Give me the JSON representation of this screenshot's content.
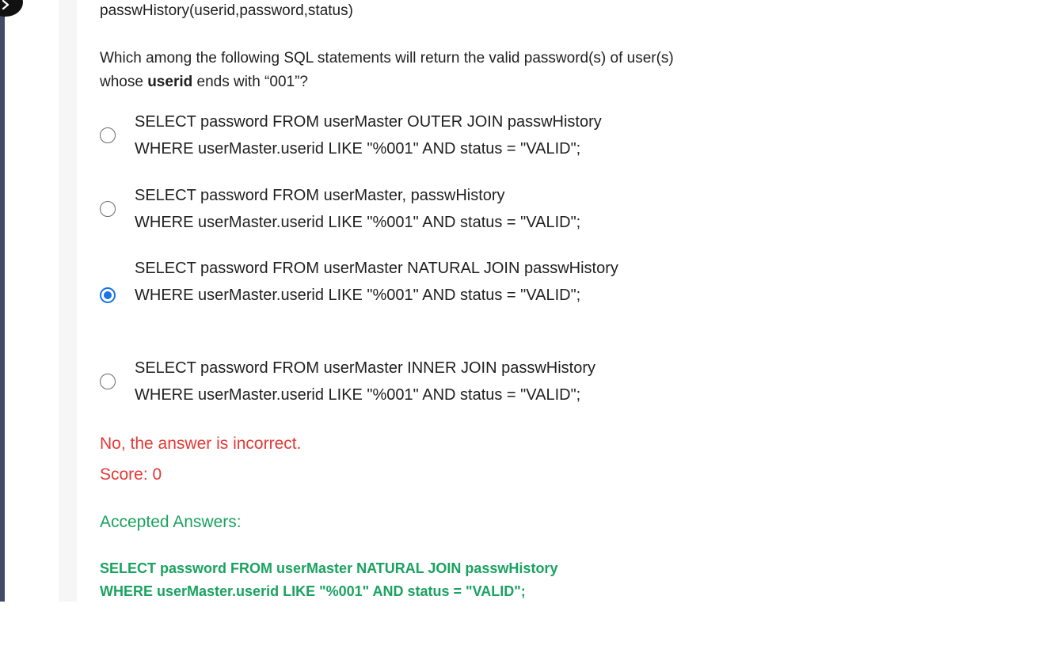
{
  "question": {
    "schema_line": "passwHistory(userid,password,status)",
    "text_prefix": "Which among the following SQL statements will return the valid password(s) of user(s) whose ",
    "text_bold": "userid",
    "text_suffix": " ends with “001”?"
  },
  "options": [
    {
      "line1": "SELECT password FROM userMaster OUTER JOIN passwHistory",
      "line2": "WHERE userMaster.userid LIKE \"%001\" AND status = \"VALID\";",
      "selected": false
    },
    {
      "line1": "SELECT password FROM userMaster, passwHistory",
      "line2": "WHERE userMaster.userid LIKE \"%001\" AND status = \"VALID\";",
      "selected": false
    },
    {
      "line1": "SELECT password FROM userMaster NATURAL JOIN passwHistory",
      "line2": "WHERE userMaster.userid LIKE \"%001\" AND status = \"VALID\";",
      "selected": true
    },
    {
      "line1": "SELECT password FROM userMaster INNER JOIN passwHistory",
      "line2": "WHERE userMaster.userid LIKE \"%001\" AND status = \"VALID\";",
      "selected": false
    }
  ],
  "feedback": {
    "result": "No, the answer is incorrect.",
    "score": "Score: 0"
  },
  "accepted": {
    "title": "Accepted Answers:",
    "line1": "SELECT password FROM userMaster NATURAL JOIN passwHistory",
    "line2": "WHERE userMaster.userid LIKE \"%001\" AND status = \"VALID\";"
  },
  "icons": {
    "nav_toggle": "chevron-right-icon"
  },
  "colors": {
    "selected_radio": "#1a73e8",
    "incorrect": "#e53935",
    "accepted": "#1aa260",
    "rail": "#414a66"
  }
}
